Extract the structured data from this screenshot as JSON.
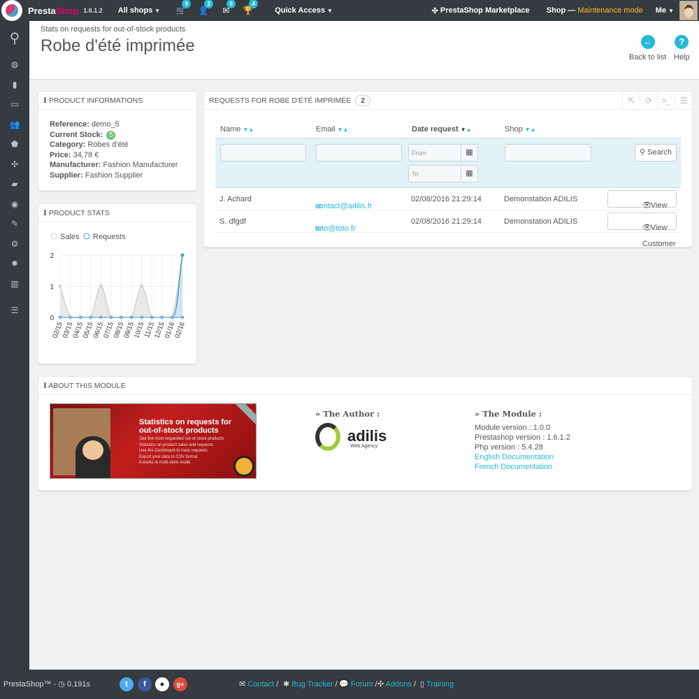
{
  "topbar": {
    "brand_presta": "Presta",
    "brand_shop": "Shop",
    "version": "1.6.1.2",
    "all_shops": "All shops",
    "cart_count": "9",
    "customers_count": "2",
    "messages_count": "5",
    "trophy_count": "4",
    "quick_access": "Quick Access",
    "marketplace": "PrestaShop Marketplace",
    "shop_label": "Shop —",
    "maintenance": "Maintenance mode",
    "me": "Me"
  },
  "page": {
    "breadcrumb": "Stats on requests for out-of-stock products",
    "title": "Robe d'été imprimée",
    "back_label": "Back to list",
    "help_label": "Help",
    "help_glyph": "?"
  },
  "product_info": {
    "heading": "PRODUCT INFORMATIONS",
    "reference_label": "Reference:",
    "reference": "demo_5",
    "stock_label": "Current Stock:",
    "stock": "5",
    "category_label": "Category:",
    "category": "Robes d'été",
    "price_label": "Price:",
    "price": "34,78 €",
    "manufacturer_label": "Manufacturer:",
    "manufacturer": "Fashion Manufacturer",
    "supplier_label": "Supplier:",
    "supplier": "Fashion Supplier"
  },
  "product_stats": {
    "heading": "PRODUCT STATS"
  },
  "chart_data": {
    "type": "area",
    "x": [
      "02/15",
      "03/15",
      "04/15",
      "05/15",
      "06/15",
      "07/15",
      "08/15",
      "09/15",
      "10/15",
      "11/15",
      "12/15",
      "01/16",
      "02/16"
    ],
    "series": [
      {
        "name": "Sales",
        "values": [
          0,
          0,
          0,
          0,
          0,
          0,
          0,
          0,
          0,
          0,
          0,
          0,
          0
        ],
        "color": "#c8c8c8"
      },
      {
        "name": "Requests",
        "values": [
          1,
          0,
          0,
          0,
          1,
          0,
          0,
          0,
          1,
          0,
          0,
          0,
          2
        ],
        "color": "#4b9bc4"
      }
    ],
    "ylim": [
      0,
      2
    ],
    "yticks": [
      "0",
      "1",
      "2"
    ],
    "legend": "top-left",
    "grid": true
  },
  "requests": {
    "heading": "REQUESTS FOR ROBE D'ÉTÉ IMPRIMÉE",
    "count": "2",
    "columns": [
      "Name",
      "Email",
      "Date request",
      "Shop"
    ],
    "from_placeholder": "From",
    "to_placeholder": "To",
    "search_label": "Search",
    "view_label": "View Customer",
    "rows": [
      {
        "name": "J. Achard",
        "email": "contact@adilis.fr",
        "date": "02/08/2016 21:29:14",
        "shop": "Demonstation ADILIS"
      },
      {
        "name": "S. dfgdf",
        "email": "toto@toto.fr",
        "date": "02/08/2016 21:29:14",
        "shop": "Demonstation ADILIS"
      }
    ]
  },
  "about": {
    "heading": "ABOUT THIS MODULE",
    "banner_title": "Statistics on requests for out-of-stock products",
    "banner_lines": [
      "See the most requested out-of-stock products",
      "Statistics on product sales and requests",
      "Use the Dashboard to track requests",
      "Export your data to CSV format",
      "It works in multi-store mode"
    ],
    "author_heading": "» The Author :",
    "author_name": "adilis",
    "author_tag": "Web Agency",
    "module_heading": "» The Module :",
    "module_version": "Module version : 1.0.0",
    "ps_version": "Prestashop version : 1.6.1.2",
    "php_version": "Php version : 5.4.28",
    "doc_en": "English Documentation",
    "doc_fr": "French Documentation"
  },
  "footer": {
    "brand": "PrestaShop™ - ",
    "time": "0.191s",
    "contact": "Contact",
    "bug": "Bug Tracker",
    "forum": "Forum",
    "addons": "Addons",
    "training": "Training",
    "sep": " /"
  }
}
